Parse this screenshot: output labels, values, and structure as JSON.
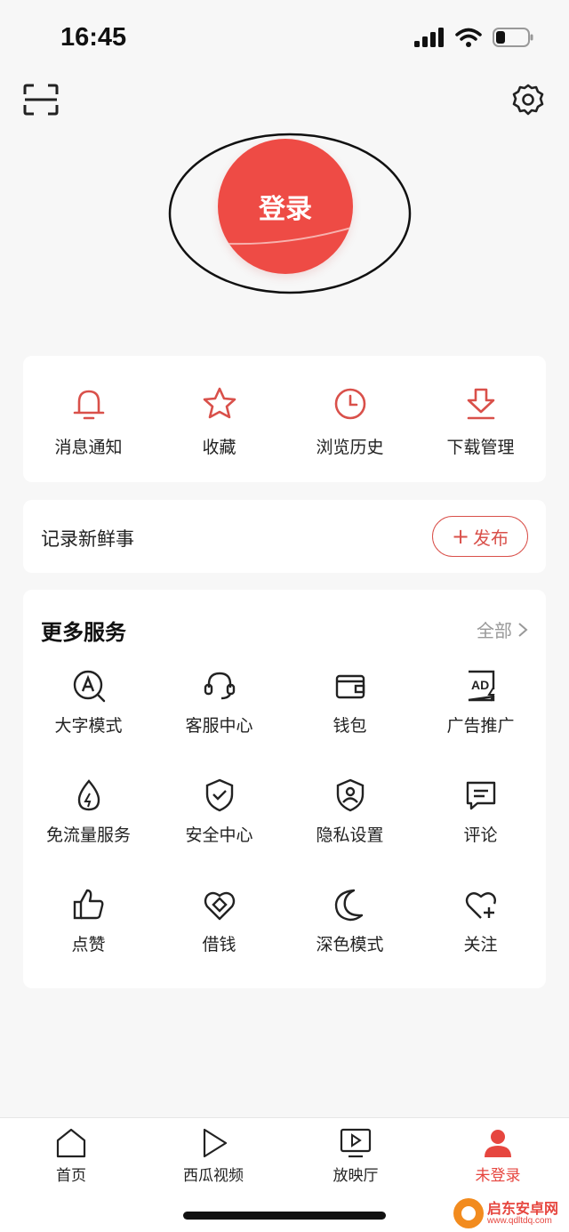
{
  "status": {
    "time": "16:45"
  },
  "login": {
    "label": "登录"
  },
  "quick_actions": [
    {
      "label": "消息通知",
      "icon": "bell-icon"
    },
    {
      "label": "收藏",
      "icon": "star-icon"
    },
    {
      "label": "浏览历史",
      "icon": "clock-icon"
    },
    {
      "label": "下载管理",
      "icon": "download-icon"
    }
  ],
  "post": {
    "prompt": "记录新鲜事",
    "button_label": "发布"
  },
  "services": {
    "title": "更多服务",
    "all_label": "全部",
    "items": [
      {
        "label": "大字模式",
        "icon": "large-font-icon"
      },
      {
        "label": "客服中心",
        "icon": "headset-icon"
      },
      {
        "label": "钱包",
        "icon": "wallet-icon"
      },
      {
        "label": "广告推广",
        "icon": "ad-icon"
      },
      {
        "label": "免流量服务",
        "icon": "data-drop-icon"
      },
      {
        "label": "安全中心",
        "icon": "shield-check-icon"
      },
      {
        "label": "隐私设置",
        "icon": "privacy-icon"
      },
      {
        "label": "评论",
        "icon": "comment-icon"
      },
      {
        "label": "点赞",
        "icon": "thumbs-up-icon"
      },
      {
        "label": "借钱",
        "icon": "loan-icon"
      },
      {
        "label": "深色模式",
        "icon": "moon-icon"
      },
      {
        "label": "关注",
        "icon": "heart-plus-icon"
      }
    ]
  },
  "tabs": [
    {
      "label": "首页",
      "icon": "home-icon"
    },
    {
      "label": "西瓜视频",
      "icon": "play-icon"
    },
    {
      "label": "放映厅",
      "icon": "tv-play-icon"
    },
    {
      "label": "未登录",
      "icon": "user-icon",
      "active": true
    }
  ],
  "watermark": {
    "title": "启东安卓网",
    "url": "www.qdltdq.com"
  },
  "colors": {
    "accent": "#ee4b45",
    "icon_red": "#d9504a",
    "active_tab": "#e6463f"
  }
}
